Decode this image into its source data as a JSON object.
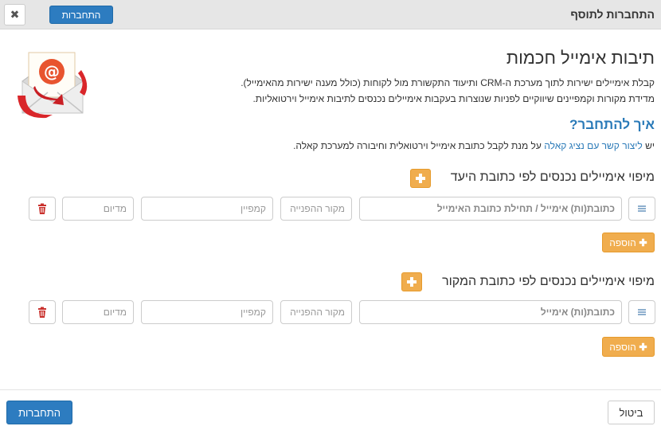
{
  "header": {
    "title": "התחברות לתוסף",
    "connect_label": "התחברות",
    "close_glyph": "✖"
  },
  "intro": {
    "title": "תיבות אימייל חכמות",
    "line1": "קבלת אימיילים ישירות לתוך מערכת ה-CRM ותיעוד התקשורת מול לקוחות (כולל מענה ישירות מהאימייל).",
    "line2": "מדידת מקורות וקמפיינים שיווקיים לפניות שנוצרות בעקבות אימיילים נכנסים לתיבות אימייל וירטואליות.",
    "howto_title": "איך להתחבר?",
    "howto_prefix": "יש",
    "howto_link": "ליצור קשר עם נציג קאלה",
    "howto_suffix": "על מנת לקבל כתובת אימייל וירטואלית וחיבורה למערכת קאלה."
  },
  "section_dest": {
    "title": "מיפוי אימיילים נכנסים לפי כתובת היעד",
    "email_placeholder": "כתובת(ות) אימייל / תחילת כתובת האימייל",
    "source_placeholder": "מקור ההפנייה",
    "campaign_placeholder": "קמפיין",
    "medium_placeholder": "מדיום",
    "add_label": "הוספה"
  },
  "section_source": {
    "title": "מיפוי אימיילים נכנסים לפי כתובת המקור",
    "email_placeholder": "כתובת(ות) אימייל",
    "source_placeholder": "מקור ההפנייה",
    "campaign_placeholder": "קמפיין",
    "medium_placeholder": "מדיום",
    "add_label": "הוספה"
  },
  "footer": {
    "cancel_label": "ביטול",
    "connect_label": "התחברות"
  },
  "colors": {
    "primary": "#2d7cc0",
    "warning": "#f0ad4e",
    "link": "#2a7ab8",
    "danger": "#c9302c"
  },
  "icons": {
    "close": "close-icon",
    "plus": "plus-icon",
    "list": "list-icon",
    "trash": "trash-icon",
    "email": "email-envelope-icon"
  }
}
